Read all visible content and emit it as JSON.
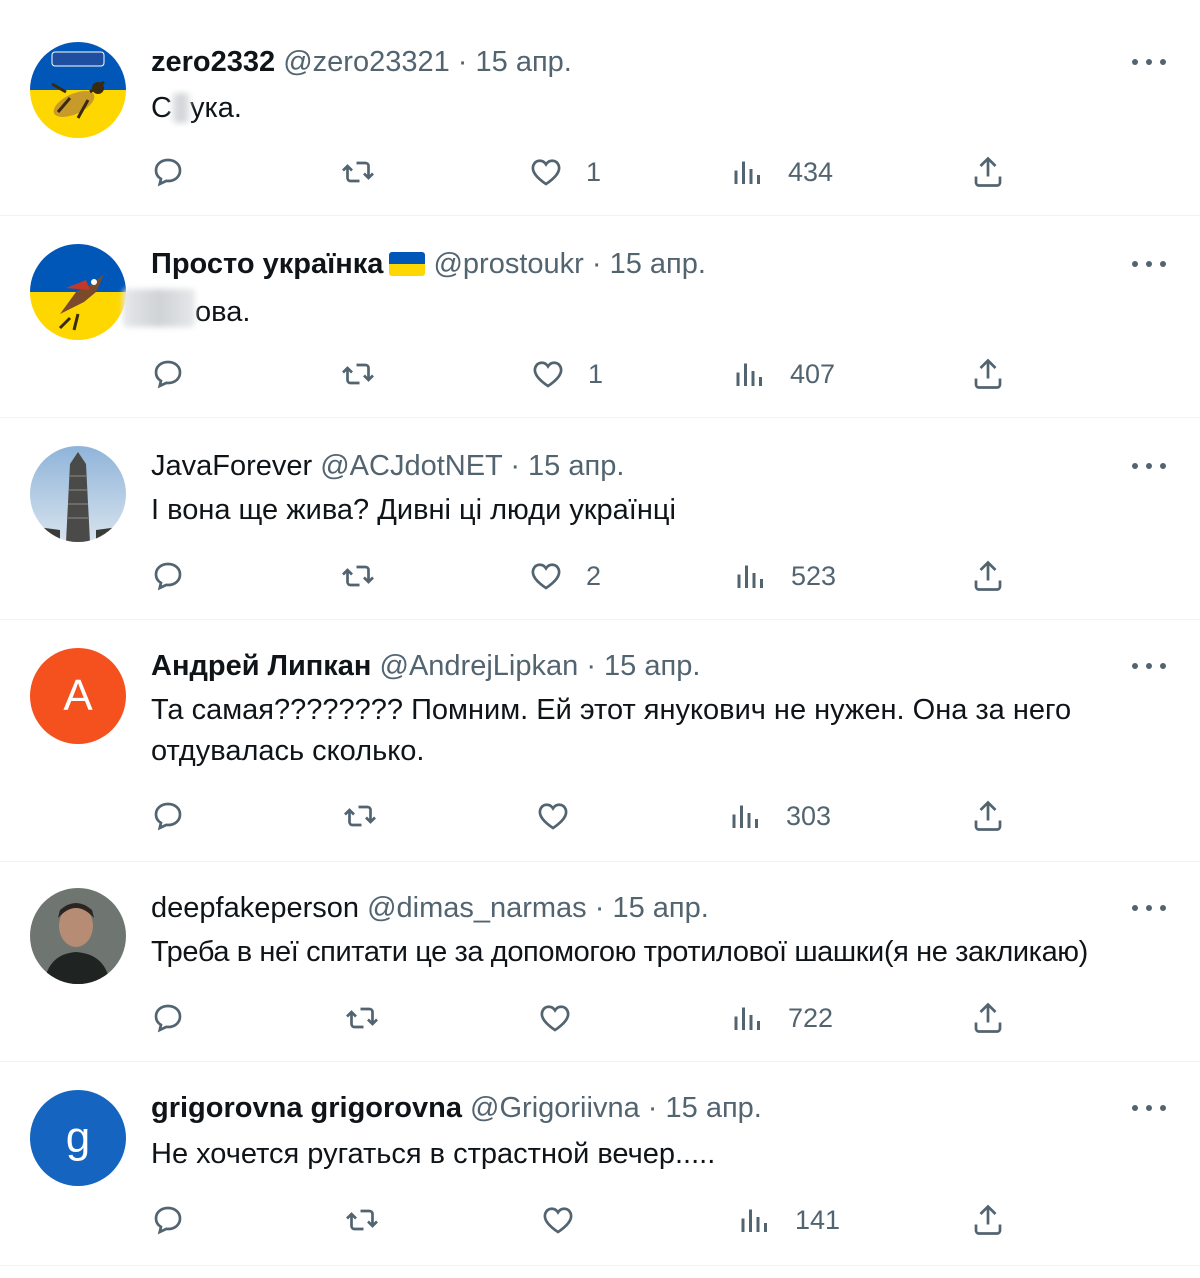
{
  "tweets": [
    {
      "name": "zero2332",
      "handle": "@zero23321",
      "dot": "·",
      "date": "15 апр.",
      "text_parts": [
        "С",
        "ука."
      ],
      "likes": "1",
      "views": "434",
      "has_flag": false
    },
    {
      "name": "Просто українка",
      "handle": "@prostoukr",
      "dot": "·",
      "date": "15 апр.",
      "text_parts": [
        "",
        "ова."
      ],
      "likes": "1",
      "views": "407",
      "has_flag": true
    },
    {
      "name": "JavaForever",
      "handle": "@ACJdotNET",
      "dot": "·",
      "date": "15 апр.",
      "text": "І вона ще жива? Дивні ці люди українці",
      "likes": "2",
      "views": "523",
      "has_flag": false
    },
    {
      "name": "Андрей Липкан",
      "handle": "@AndrejLipkan",
      "dot": "·",
      "date": "15 апр.",
      "text": "Та самая???????? Помним. Ей этот янукович не нужен. Она за него отдувалась сколько.",
      "avatar_letter": "A",
      "likes": "",
      "views": "303",
      "has_flag": false
    },
    {
      "name": "deepfakeperson",
      "handle": "@dimas_narmas",
      "dot": "·",
      "date": "15 апр.",
      "text": "Треба в неї спитати це за допомогою тротилової шашки(я не закликаю)",
      "likes": "",
      "views": "722",
      "has_flag": false
    },
    {
      "name": "grigorovna grigorovna",
      "handle": "@Grigoriivna",
      "dot": "·",
      "date": "15 апр.",
      "text": "Не хочется ругаться в страстной вечер.....",
      "avatar_letter": "g",
      "likes": "",
      "views": "141",
      "has_flag": false
    }
  ],
  "icons": {
    "reply": "reply-icon",
    "retweet": "retweet-icon",
    "like": "heart-icon",
    "views": "views-chart-icon",
    "share": "share-icon",
    "more": "more-dots-icon"
  },
  "colors": {
    "name": "#0f1419",
    "muted": "#536471",
    "divider": "#eff3f4",
    "ukraine_blue": "#0057b7",
    "ukraine_yellow": "#ffd700",
    "avatar_orange": "#f4511e",
    "avatar_blue": "#1565c0"
  }
}
